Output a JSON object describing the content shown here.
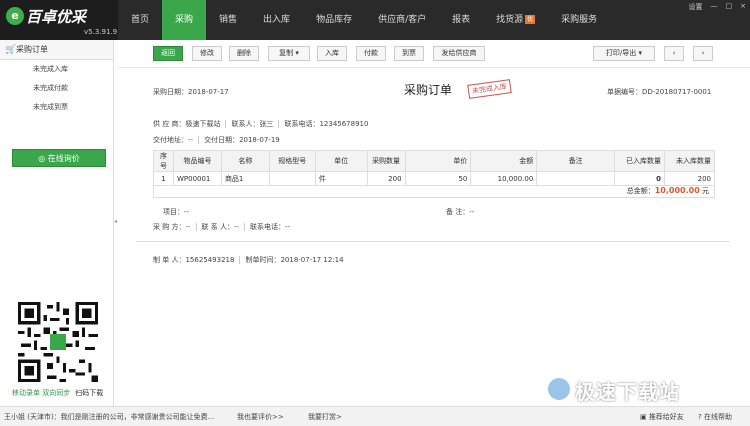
{
  "app": {
    "logo_mark": "e",
    "logo_name": "百卓优采",
    "version": "v5.3.91.9"
  },
  "nav": [
    {
      "label": "首页",
      "active": false
    },
    {
      "label": "采购",
      "active": true
    },
    {
      "label": "销售",
      "active": false
    },
    {
      "label": "出入库",
      "active": false
    },
    {
      "label": "物品库存",
      "active": false
    },
    {
      "label": "供应商/客户",
      "active": false
    },
    {
      "label": "报表",
      "active": false
    },
    {
      "label": "找货源",
      "active": false,
      "badge": "优"
    },
    {
      "label": "采购服务",
      "active": false
    }
  ],
  "window_controls": {
    "settings": "设置",
    "minimize": "—",
    "maximize": "□",
    "close": "×"
  },
  "sidebar": {
    "header": "采购订单",
    "items": [
      "未完成入库",
      "未完成付款",
      "未完成到票"
    ],
    "ask_button": "在线询价",
    "qr_caption": "移动录单 双向同步",
    "qr_caption2": "扫码下载"
  },
  "toolbar": {
    "back": "返回",
    "edit": "修改",
    "delete": "删除",
    "copy": "复制",
    "stock_in": "入库",
    "pay": "付款",
    "invoice": "到票",
    "send": "发给供应商",
    "print": "打印/导出",
    "prev": "‹",
    "next": "›"
  },
  "document": {
    "title": "采购订单",
    "stamp": "未完成入库",
    "date_label": "采购日期：",
    "date": "2018-07-17",
    "doc_no_label": "单据编号：",
    "doc_no": "DD-20180717-0001",
    "supplier_label": "供 应 商：",
    "supplier": "极速下载站",
    "contact_label": "联系人：",
    "contact": "张三",
    "phone_label": "联系电话：",
    "phone": "12345678910",
    "delivery_addr_label": "交付地址：",
    "delivery_addr": "--",
    "delivery_date_label": "交付日期：",
    "delivery_date": "2018-07-19",
    "project_label": "项目：",
    "project": "--",
    "remark_label": "备 注：",
    "remark": "--",
    "buyer_label": "采 购 方：",
    "buyer": "--",
    "buyer_contact_label": "联 系 人：",
    "buyer_contact": "--",
    "buyer_phone_label": "联系电话：",
    "buyer_phone": "--",
    "maker_label": "制 单 人：",
    "maker": "15625493218",
    "made_time_label": "制单时间：",
    "made_time": "2018-07-17 12:14"
  },
  "table": {
    "headers": [
      "序号",
      "物品编号",
      "名称",
      "规格型号",
      "单位",
      "采购数量",
      "单价",
      "金额",
      "备注",
      "已入库数量",
      "未入库数量"
    ],
    "rows": [
      {
        "no": "1",
        "code": "WP00001",
        "name": "商品1",
        "spec": "",
        "unit": "件",
        "qty": "200",
        "price": "50",
        "amount": "10,000.00",
        "remark": "",
        "in_qty": "0",
        "pending_qty": "200"
      }
    ],
    "total_label": "总金额：",
    "total": "10,000.00",
    "total_unit": "元"
  },
  "status": {
    "left": "王小姐 (天津市)：我们是刚注册的公司，非常感谢贵公司能让免费...",
    "rate": "我也要评价>>",
    "reward": "我要打赏>",
    "recommend": "推荐给好友",
    "help": "在线帮助"
  },
  "watermark": "极速下载站",
  "colors": {
    "brand_green": "#3aa74a",
    "topbar": "#2a2a2a",
    "accent_red": "#e2472f"
  }
}
